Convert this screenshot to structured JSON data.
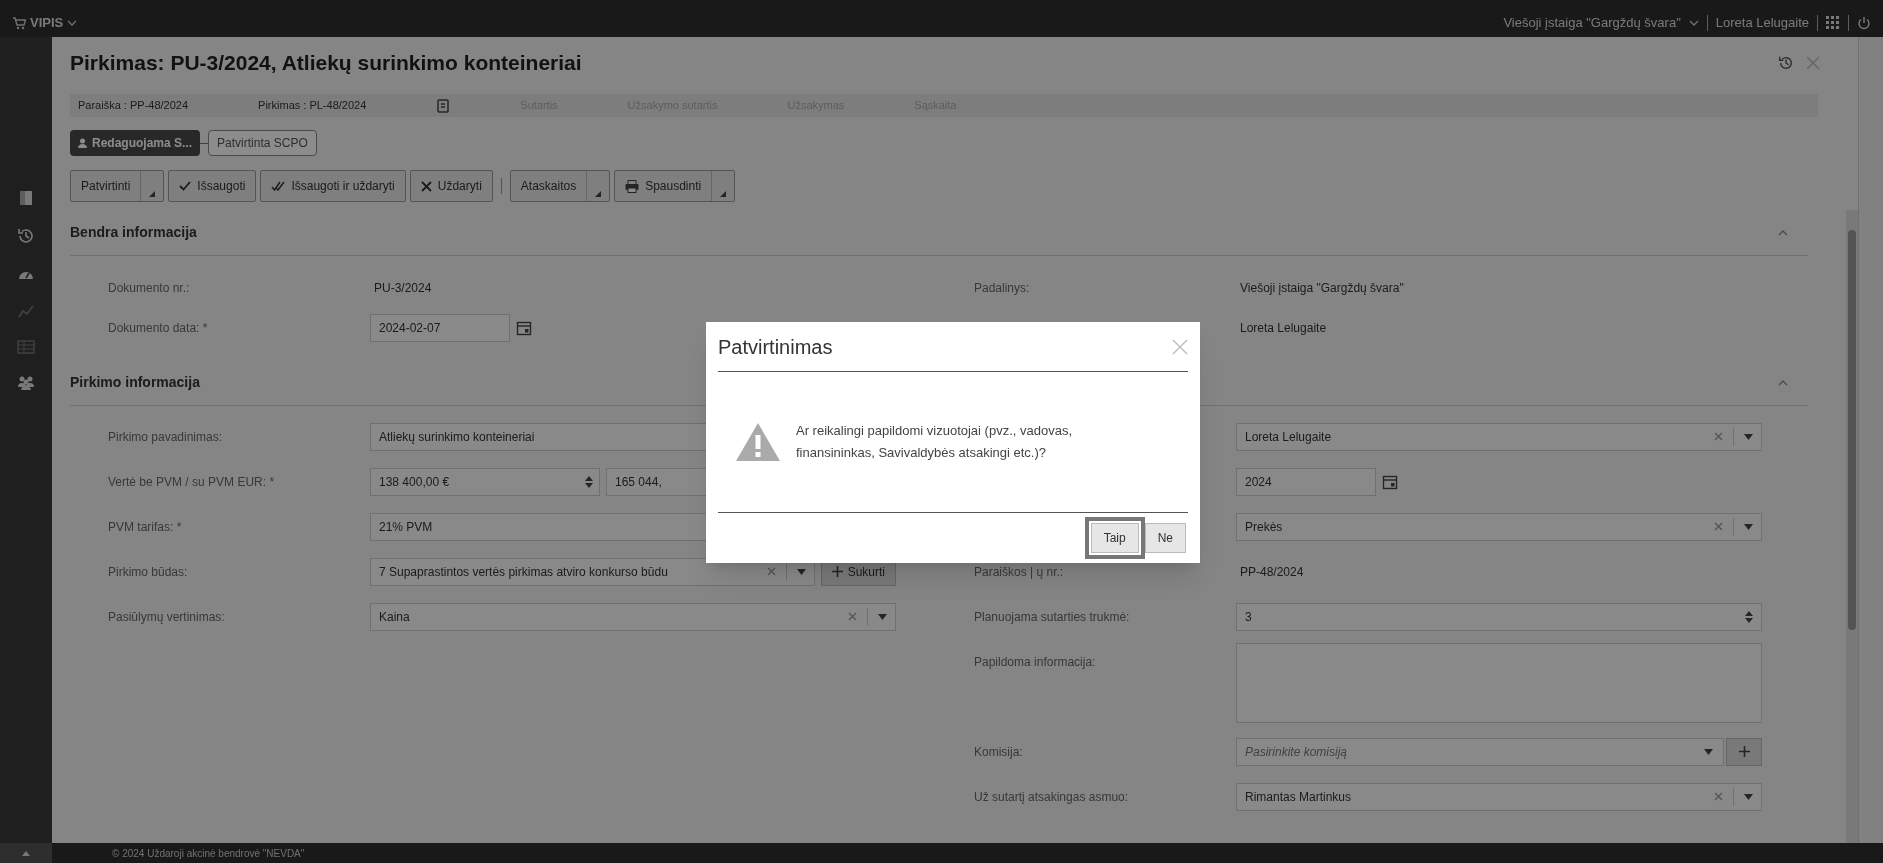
{
  "app_bar": {
    "app_name": "VIPIS",
    "organization": "Viešoji įstaiga \"Gargždų švara\"",
    "user": "Loreta Lelugaite"
  },
  "title": "Pirkimas: PU-3/2024, Atliekų surinkimo konteineriai",
  "steps": [
    {
      "kind": "link",
      "label": "Paraiška : PP-48/2024",
      "disabled": false
    },
    {
      "kind": "link",
      "label": "Pirkimas : PL-48/2024",
      "disabled": false
    },
    {
      "kind": "icon",
      "disabled": false
    },
    {
      "kind": "link",
      "label": "Sutartis",
      "disabled": true
    },
    {
      "kind": "link",
      "label": "Užsakymo sutartis",
      "disabled": true
    },
    {
      "kind": "link",
      "label": "Užsakymas",
      "disabled": true
    },
    {
      "kind": "link",
      "label": "Sąskaita",
      "disabled": true
    }
  ],
  "statuses": [
    {
      "label": "Redaguojama S...",
      "selected": true
    },
    {
      "label": "Patvirtinta SCPO",
      "selected": false
    }
  ],
  "toolbar_groups": [
    {
      "buttons": [
        {
          "label": "Patvirtinti",
          "kind": "plain",
          "menu": true
        },
        {
          "label": "Išsaugoti",
          "kind": "save",
          "menu": false
        },
        {
          "label": "Išsaugoti ir uždaryti",
          "kind": "save_close",
          "menu": false
        },
        {
          "label": "Uždaryti",
          "kind": "close",
          "menu": false
        }
      ]
    },
    {
      "buttons": [
        {
          "label": "Ataskaitos",
          "kind": "plain",
          "menu": true
        },
        {
          "label": "Spausdinti",
          "kind": "print",
          "menu": true
        }
      ]
    }
  ],
  "sections": [
    {
      "title": "Bendra informacija",
      "expanded": true,
      "left": [
        {
          "label": "Dokumento nr.:",
          "kind": "static",
          "value": "PU-3/2024"
        },
        {
          "label": "Dokumento data: *",
          "kind": "date",
          "value": "2024-02-07"
        }
      ],
      "right": [
        {
          "label": "Padalinys:",
          "kind": "static",
          "value": "Viešoji įstaiga \"Gargždų švara\""
        },
        {
          "kind": "static",
          "value": "Loreta Lelugaite"
        }
      ]
    },
    {
      "title": "Pirkimo informacija",
      "expanded": true,
      "left": [
        {
          "label": "Pirkimo pavadinimas:",
          "kind": "text",
          "value": "Atliekų surinkimo konteineriai"
        },
        {
          "label": "Vertė be PVM / su PVM EUR: *",
          "kind": "money_pair",
          "values": [
            "138 400,00 €",
            "165 044,"
          ]
        },
        {
          "label": "PVM tarifas: *",
          "kind": "select",
          "value": "21% PVM"
        },
        {
          "label": "Pirkimo būdas:",
          "kind": "select_add",
          "value": "7 Supaprastintos vertės pirkimas atviro konkurso būdu",
          "button": "Sukurti"
        },
        {
          "label": "Pasiūlymų vertinimas:",
          "kind": "select",
          "value": "Kaina"
        }
      ],
      "right": [
        {
          "kind": "select",
          "value": "Loreta Lelugaite"
        },
        {
          "kind": "date",
          "value": "2024"
        },
        {
          "kind": "select",
          "value": "Prekės"
        },
        {
          "label": "Paraiškos | ų nr.:",
          "kind": "static",
          "value": "PP-48/2024"
        },
        {
          "label": "Planuojama sutarties trukmė:",
          "kind": "spinner",
          "value": "3"
        },
        {
          "label": "Papildoma informacija:",
          "kind": "textarea"
        },
        {
          "label": "Komisija:",
          "kind": "combo_add",
          "placeholder": "Pasirinkite komisiją"
        },
        {
          "label": "Už sutartį atsakingas asmuo:",
          "kind": "select",
          "value": "Rimantas Martinkus"
        }
      ]
    }
  ],
  "dialog": {
    "title": "Patvirtinimas",
    "message": "Ar reikalingi papildomi vizuotojai (pvz., vadovas, finansininkas, Savivaldybės atsakingi etc.)?",
    "buttons": [
      {
        "label": "Taip",
        "focused": true
      },
      {
        "label": "Ne",
        "focused": false
      }
    ]
  },
  "footer": {
    "copyright": "© 2024 Uždaroji akcinė bendrovė \"NEVDA\""
  }
}
